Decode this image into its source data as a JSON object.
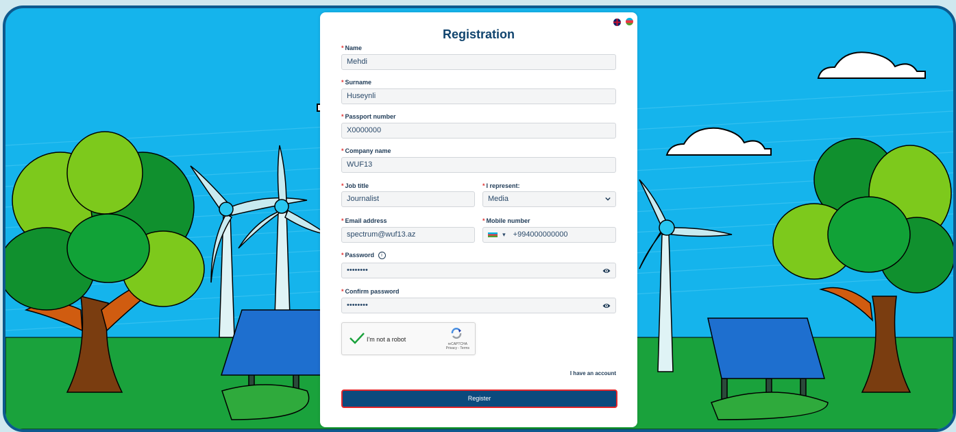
{
  "form": {
    "title": "Registration",
    "required_mark": "*",
    "name": {
      "label": "Name",
      "value": "Mehdi"
    },
    "surname": {
      "label": "Surname",
      "value": "Huseynli"
    },
    "passport": {
      "label": "Passport number",
      "value": "X0000000"
    },
    "company": {
      "label": "Company name",
      "value": "WUF13"
    },
    "job_title": {
      "label": "Job title",
      "value": "Journalist"
    },
    "represent": {
      "label": "I represent:",
      "value": "Media"
    },
    "email": {
      "label": "Email address",
      "value": "spectrum@wuf13.az"
    },
    "mobile": {
      "label": "Mobile number",
      "value": "+994000000000"
    },
    "password": {
      "label": "Password",
      "info": "i",
      "value": "••••••••"
    },
    "confirm_password": {
      "label": "Confirm password",
      "value": "••••••••"
    },
    "recaptcha": {
      "label": "I'm not a robot",
      "brand": "reCAPTCHA",
      "links": "Privacy - Terms"
    },
    "account_link": "I have an account",
    "submit_label": "Register"
  },
  "languages": [
    "english-flag",
    "azerbaijan-flag"
  ],
  "colors": {
    "primary": "#0b4a7d",
    "title": "#10446e",
    "required": "#e03535",
    "sky": "#15b4ec",
    "grass": "#1aa23c"
  }
}
